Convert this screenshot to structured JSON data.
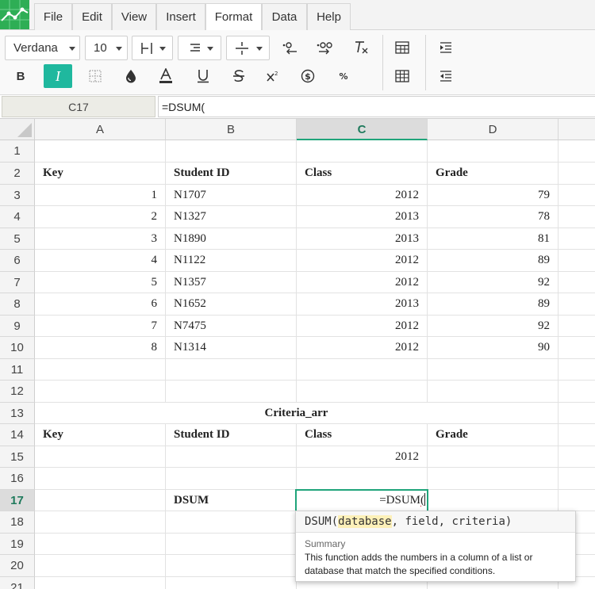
{
  "menu": [
    "File",
    "Edit",
    "View",
    "Insert",
    "Format",
    "Data",
    "Help"
  ],
  "toolbar": {
    "font": "Verdana",
    "size": "10"
  },
  "formula_bar": {
    "name_box": "C17",
    "formula": "=DSUM("
  },
  "columns": [
    "A",
    "B",
    "C",
    "D"
  ],
  "rows": [
    "1",
    "2",
    "3",
    "4",
    "5",
    "6",
    "7",
    "8",
    "9",
    "10",
    "11",
    "12",
    "13",
    "14",
    "15",
    "16",
    "17",
    "18",
    "19",
    "20",
    "21"
  ],
  "table": {
    "headers": [
      "Key",
      "Student ID",
      "Class",
      "Grade"
    ],
    "data": [
      [
        "1",
        "N1707",
        "2012",
        "79"
      ],
      [
        "2",
        "N1327",
        "2013",
        "78"
      ],
      [
        "3",
        "N1890",
        "2013",
        "81"
      ],
      [
        "4",
        "N1122",
        "2012",
        "89"
      ],
      [
        "5",
        "N1357",
        "2012",
        "92"
      ],
      [
        "6",
        "N1652",
        "2013",
        "89"
      ],
      [
        "7",
        "N7475",
        "2012",
        "92"
      ],
      [
        "8",
        "N1314",
        "2012",
        "90"
      ]
    ]
  },
  "criteria": {
    "title": "Criteria_arr",
    "headers": [
      "Key",
      "Student ID",
      "Class",
      "Grade"
    ],
    "class_value": "2012"
  },
  "dsum": {
    "label": "DSUM",
    "editing_prefix": "=DSUM",
    "editing_paren": "("
  },
  "tooltip": {
    "fn": "DSUM(",
    "arg1": "database",
    "rest": ", field, criteria)",
    "summary_label": "Summary",
    "description": "This function adds the numbers in a column of a list or database that match the specified conditions."
  },
  "colors": {
    "accent": "#1fb89e",
    "logo": "#2eae55",
    "selection": "#1fa47a"
  }
}
